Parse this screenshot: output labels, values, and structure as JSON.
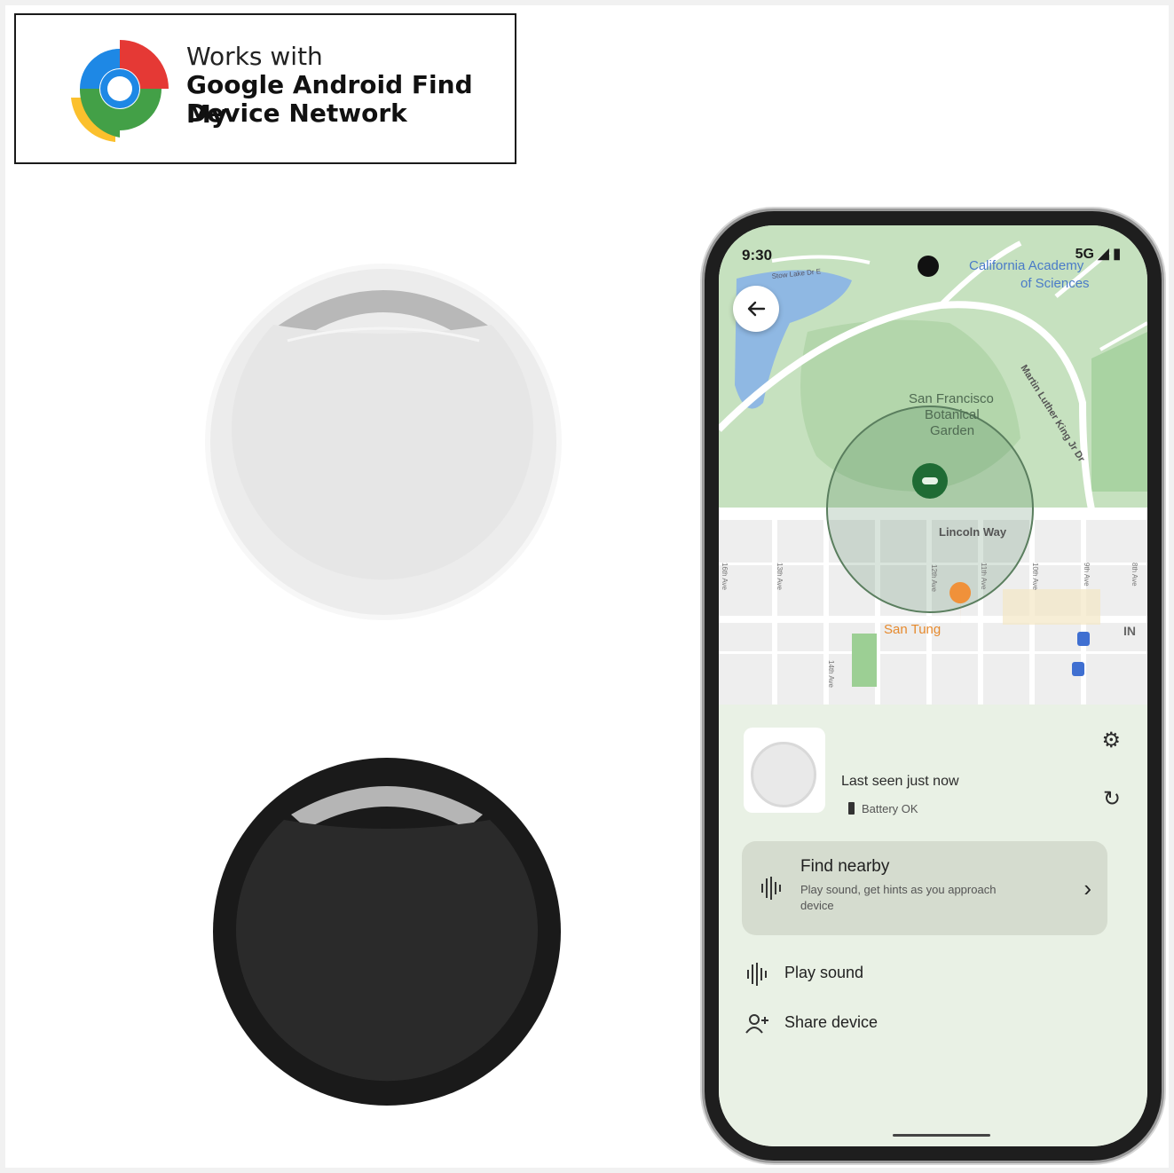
{
  "badge": {
    "line1": "Works with",
    "line2": "Google Android Find My",
    "line3": "Device Network"
  },
  "phone": {
    "status_time": "9:30",
    "status_right": "5G",
    "map": {
      "labels": {
        "academy": "California Academy",
        "academy2": "of Sciences",
        "garden1": "San Francisco",
        "garden2": "Botanical",
        "garden3": "Garden",
        "mlk": "Martin Luther King Jr Dr",
        "lincoln": "Lincoln Way",
        "stow": "Stow Lake Dr E",
        "san_tung": "San Tung",
        "in": "IN",
        "ave13": "13th Ave",
        "ave12": "12th Ave",
        "ave11": "11th Ave",
        "ave10": "10th Ave",
        "ave9": "9th Ave",
        "ave8": "8th Ave",
        "ave14": "14th Ave",
        "ave16": "16th Ave"
      }
    },
    "device": {
      "last_seen": "Last seen just now",
      "battery": "Battery OK"
    },
    "find_nearby": {
      "title": "Find nearby",
      "subtitle": "Play sound, get hints as you approach device"
    },
    "actions": {
      "play_sound": "Play sound",
      "share_device": "Share device"
    }
  },
  "colors": {
    "map_green": "#c9e2c3",
    "map_dark_green": "#a9d3a2",
    "water": "#8fb8e3",
    "accent_green": "#1f6b34",
    "sheet_bg": "#e9f1e5"
  }
}
